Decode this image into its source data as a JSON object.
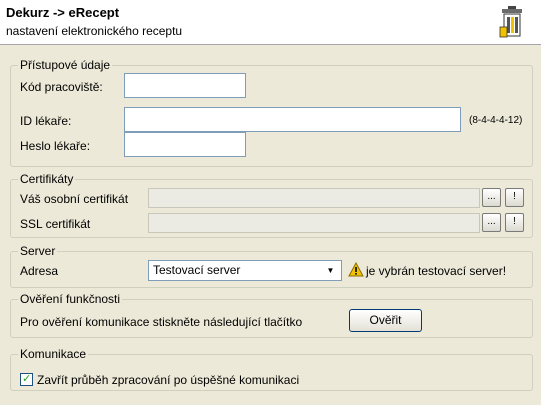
{
  "header": {
    "title": "Dekurz -> eRecept",
    "subtitle": "nastavení elektronického receptu",
    "icon": "trash-bin-icon"
  },
  "access": {
    "group_title": "Přístupové údaje",
    "workplace_label": "Kód pracoviště:",
    "workplace_value": "",
    "doctor_id_label": "ID lékaře:",
    "doctor_id_value": "",
    "doctor_id_hint": "(8-4-4-4-12)",
    "password_label": "Heslo lékaře:",
    "password_value": ""
  },
  "certificates": {
    "group_title": "Certifikáty",
    "personal_label": "Váš osobní certifikát",
    "personal_value": "",
    "ssl_label": "SSL certifikát",
    "ssl_value": "",
    "browse_label": "...",
    "info_label": "!"
  },
  "server": {
    "group_title": "Server",
    "address_label": "Adresa",
    "selected": "Testovací server",
    "warning": "je vybrán testovací server!",
    "warning_color": "#f2c200"
  },
  "verify": {
    "group_title": "Ověření funkčnosti",
    "text": "Pro ověření komunikace stiskněte následující tlačítko",
    "button_label": "Ověřit"
  },
  "communication": {
    "group_title": "Komunikace",
    "close_checkbox_label": "Zavřít průběh zpracování po úspěšné komunikaci",
    "close_checkbox_checked": true
  }
}
